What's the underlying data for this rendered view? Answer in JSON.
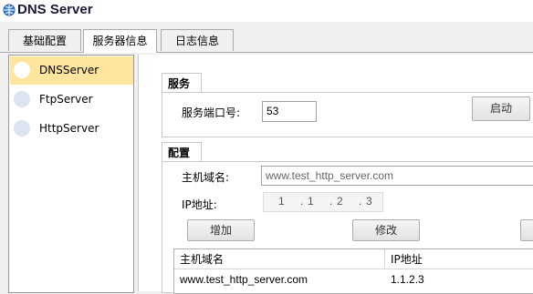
{
  "window": {
    "title": "DNS Server",
    "icon": "network-globe-icon"
  },
  "tabs": [
    {
      "label": "基础配置",
      "active": false
    },
    {
      "label": "服务器信息",
      "active": true
    },
    {
      "label": "日志信息",
      "active": false
    }
  ],
  "sidebar": {
    "items": [
      {
        "label": "DNSServer",
        "selected": true,
        "icon": "circle-icon"
      },
      {
        "label": "FtpServer",
        "selected": false,
        "icon": "circle-icon"
      },
      {
        "label": "HttpServer",
        "selected": false,
        "icon": "circle-icon"
      }
    ]
  },
  "service": {
    "section_label": "服务",
    "port_label": "服务端口号:",
    "port_value": "53",
    "start_label": "启动"
  },
  "config": {
    "section_label": "配置",
    "host_label": "主机域名:",
    "host_value": "www.test_http_server.com",
    "ip_label": "IP地址:",
    "ip_octets": [
      "1",
      "1",
      "2",
      "3"
    ],
    "add_label": "增加",
    "modify_label": "修改",
    "table": {
      "headers": [
        "主机域名",
        "IP地址"
      ],
      "rows": [
        [
          "www.test_http_server.com",
          "1.1.2.3"
        ]
      ]
    }
  },
  "colors": {
    "selected_bg": "#ffe59e",
    "title_text": "#1a1a3a"
  }
}
